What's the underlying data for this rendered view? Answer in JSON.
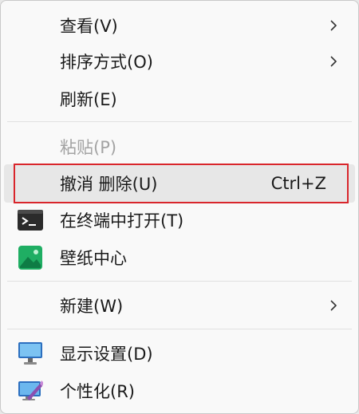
{
  "menu": {
    "items": [
      {
        "label": "查看(V)"
      },
      {
        "label": "排序方式(O)"
      },
      {
        "label": "刷新(E)"
      },
      {
        "label": "粘贴(P)"
      },
      {
        "label": "撤消 删除(U)",
        "shortcut": "Ctrl+Z"
      },
      {
        "label": "在终端中打开(T)",
        "icon": "terminal-icon"
      },
      {
        "label": "壁纸中心",
        "icon": "wallpaper-icon"
      },
      {
        "label": "新建(W)"
      },
      {
        "label": "显示设置(D)",
        "icon": "display-icon"
      },
      {
        "label": "个性化(R)",
        "icon": "personalize-icon"
      }
    ]
  },
  "colors": {
    "highlight_border": "#d9262c",
    "disabled_text": "#a3a3a3",
    "wallpaper_green": "#1fae63"
  }
}
